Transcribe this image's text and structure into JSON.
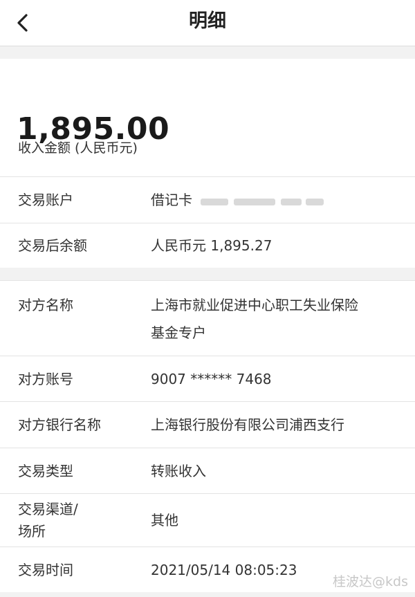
{
  "nav": {
    "title": "明细",
    "back_icon": "chevron-left-icon"
  },
  "amount": {
    "label": "收入金额 (人民币元)",
    "value": "1,895.00"
  },
  "account_section": [
    {
      "label": "交易账户",
      "value": "借记卡"
    },
    {
      "label": "交易后余额",
      "value": "人民币元 1,895.27"
    }
  ],
  "detail_section": [
    {
      "label": "对方名称",
      "value_line1": "上海市就业促进中心职工失业保险",
      "value_line2": "基金专户"
    },
    {
      "label": "对方账号",
      "value": "9007 ****** 7468"
    },
    {
      "label": "对方银行名称",
      "value": "上海银行股份有限公司浦西支行"
    },
    {
      "label": "交易类型",
      "value": "转账收入"
    },
    {
      "label_line1": "交易渠道/",
      "label_line2": "场所",
      "value": "其他"
    },
    {
      "label": "交易时间",
      "value": "2021/05/14 08:05:23"
    }
  ],
  "watermark": "桂波达@kds",
  "colors": {
    "background": "#f2f2f2",
    "card": "#ffffff",
    "text": "#333333",
    "divider": "#e3e3e3"
  }
}
